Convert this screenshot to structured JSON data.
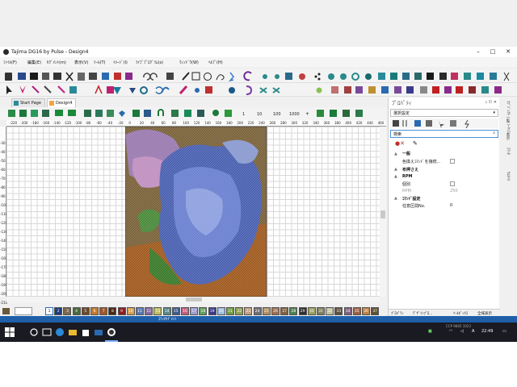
{
  "window": {
    "title": "Tajima DG16 by Pulse - Design4"
  },
  "menu": [
    "ﾌｧｲﾙ(F)",
    "編集(E)",
    "ｾｸﾞﾒﾝﾄ(m)",
    "表示(V)",
    "ﾂｰﾙ(T)",
    "ｲﾒｰｼﾞ(I)",
    "ﾗｲﾌﾞﾌﾟﾛｸﾞﾗﾑ(s)",
    "ｳｨﾝﾄﾞｳ(W)",
    "ﾍﾙﾌﾟ(H)"
  ],
  "doc_tabs": [
    "Start Page",
    "Design4"
  ],
  "toolbar3": {
    "counter_labels": [
      "1",
      "10",
      "100",
      "1000",
      "+"
    ]
  },
  "ruler_h": [
    "-220",
    "-200",
    "-180",
    "-160",
    "-140",
    "-120",
    "-100",
    "-80",
    "-60",
    "-40",
    "-20",
    "0",
    "20",
    "40",
    "60",
    "80",
    "100",
    "120",
    "140",
    "160",
    "180",
    "200",
    "220",
    "240",
    "260",
    "280",
    "300",
    "320",
    "340",
    "360",
    "380",
    "400",
    "420",
    "440",
    "460"
  ],
  "ruler_v": [
    "-30",
    "-40",
    "-50",
    "-60",
    "-70",
    "-80",
    "-90",
    "-100",
    "-110",
    "-120",
    "-130",
    "-140",
    "-150",
    "-160",
    "-170",
    "-180",
    "-190",
    "-200",
    "-210"
  ],
  "palette": {
    "numbers": [
      "1",
      "2",
      "3",
      "4",
      "5",
      "6",
      "7",
      "8",
      "9",
      "10",
      "11",
      "12",
      "13",
      "14",
      "15",
      "16",
      "17",
      "18",
      "19",
      "20",
      "21",
      "22",
      "23",
      "24",
      "25",
      "26",
      "27",
      "28",
      "29",
      "30",
      "31",
      "32",
      "33",
      "34",
      "35",
      "36",
      "37"
    ],
    "colors": [
      "#ffffff",
      "#1f3d7a",
      "#7a6a50",
      "#4a6b3a",
      "#6b4a2a",
      "#c97a2a",
      "#a05a2a",
      "#4a2a1a",
      "#8a1e1e",
      "#d8a050",
      "#5a7ab0",
      "#8a6aa0",
      "#c0c060",
      "#5a8a8a",
      "#405a90",
      "#c06080",
      "#a0a0d0",
      "#60a060",
      "#3a3a8a",
      "#a0c0e0",
      "#70a040",
      "#90a050",
      "#c0a080",
      "#707070",
      "#b09060",
      "#a07050",
      "#806040",
      "#508050",
      "#303030",
      "#a0a060",
      "#808060",
      "#c0c0a0",
      "#605040",
      "#806080",
      "#a06040",
      "#c08040",
      "#605030"
    ],
    "current_input": ""
  },
  "status": {
    "text": "ｽﾃｯﾁｾｸﾞﾒﾝﾄ"
  },
  "properties": {
    "title": "ﾌﾟﾛﾊﾟﾃｨ",
    "controls": "ｭ ㅁ ✕",
    "selection": "選択設定",
    "search_placeholder": "検索",
    "rows": [
      {
        "label": "一般",
        "head": true
      },
      {
        "label": "色換えｺﾏﾝﾄﾞを接続...",
        "head": false,
        "checkbox": true
      },
      {
        "label": "布押さえ",
        "head": true
      },
      {
        "label": "RPM",
        "head": true
      },
      {
        "label": "個別",
        "head": false,
        "checkbox": true
      },
      {
        "label": "RPM",
        "head": false,
        "value": "250",
        "muted": true
      },
      {
        "label": "ｺﾏﾝﾄﾞ設定",
        "head": true
      },
      {
        "label": "任意区間No.",
        "head": false,
        "value": "0"
      }
    ],
    "bottom_tabs": [
      "ﾌﾟﾛﾊﾟﾃｨ",
      "ﾃﾞｻﾞｲﾝﾌﾟﾛ...",
      "ﾂｰﾙﾎﾞｯｸｽ",
      "全域表示"
    ]
  },
  "side_tabs": [
    "ｵﾌﾞｼﾞｪｸﾄ一覧 ｼｰｹﾝｽ表示",
    "ｽﾃｯﾁ",
    "ｻﾑﾈｲﾙ"
  ],
  "taskbar": {
    "language": "A",
    "time": "22:49",
    "tray_note": "CCP 9845 1023"
  }
}
